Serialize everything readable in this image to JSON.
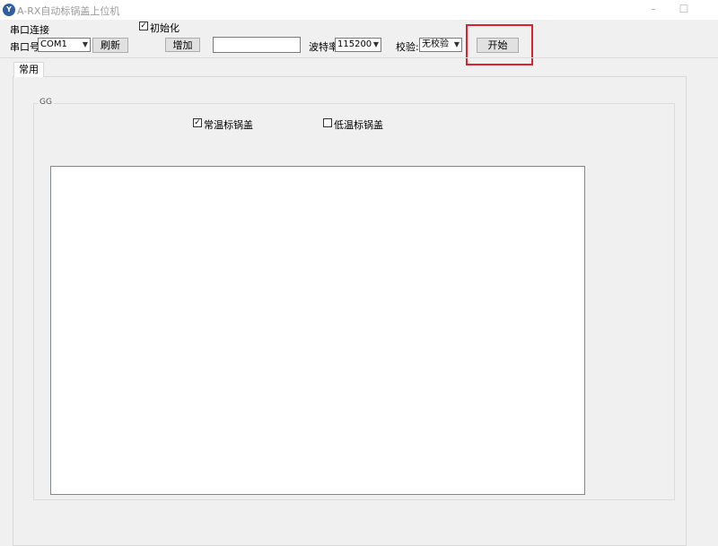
{
  "window": {
    "title": "A-RX自动标锅盖上位机",
    "icon_text": "Y",
    "minimize_icon": "–",
    "maximize_icon": "☐"
  },
  "serial": {
    "group_label": "串口连接",
    "init_checkbox_label": "初始化",
    "init_checked": true,
    "port_label": "串口号:",
    "port_value": "COM1",
    "refresh_label": "刷新",
    "add_label": "增加",
    "text_value": "",
    "baud_label": "波特率:",
    "baud_value": "115200",
    "parity_label": "校验:",
    "parity_value": "无校验",
    "start_label": "开始"
  },
  "tabs": [
    {
      "label": "常用",
      "selected": true
    }
  ],
  "group": {
    "title": "GG",
    "option_normal_label": "常温标锅盖",
    "option_normal_checked": true,
    "option_low_label": "低温标锅盖",
    "option_low_checked": false
  },
  "colors": {
    "highlight": "#d9232e",
    "background": "#f0f0f0"
  }
}
